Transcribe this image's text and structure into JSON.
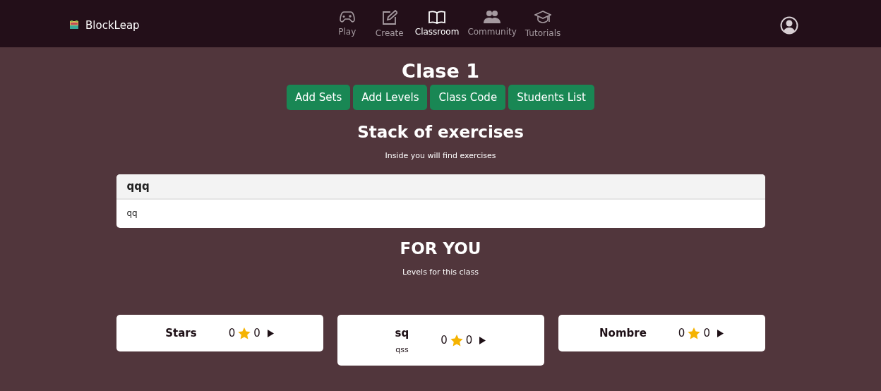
{
  "brand": {
    "name": "BlockLeap"
  },
  "nav": [
    {
      "label": "Play",
      "kind": "gamepad",
      "selected": false
    },
    {
      "label": "Create",
      "kind": "edit",
      "selected": false
    },
    {
      "label": "Classroom",
      "kind": "book",
      "selected": true
    },
    {
      "label": "Community",
      "kind": "people",
      "selected": false
    },
    {
      "label": "Tutorials",
      "kind": "graduation",
      "selected": false
    }
  ],
  "title": "Clase 1",
  "actions": [
    "Add Sets",
    "Add Levels",
    "Class Code",
    "Students List"
  ],
  "stack": {
    "title": "Stack of exercises",
    "subtitle": "Inside you will find exercises"
  },
  "sets": [
    {
      "title": "qqq",
      "description": "qq"
    }
  ],
  "for_you": {
    "title": "FOR YOU",
    "subtitle": "Levels for this class"
  },
  "levels": [
    {
      "name": "Stars",
      "rating": "0",
      "count": "0"
    },
    {
      "name": "sq",
      "description": "qss",
      "rating": "0",
      "count": "0"
    },
    {
      "name": "Nombre",
      "rating": "0",
      "count": "0"
    }
  ]
}
